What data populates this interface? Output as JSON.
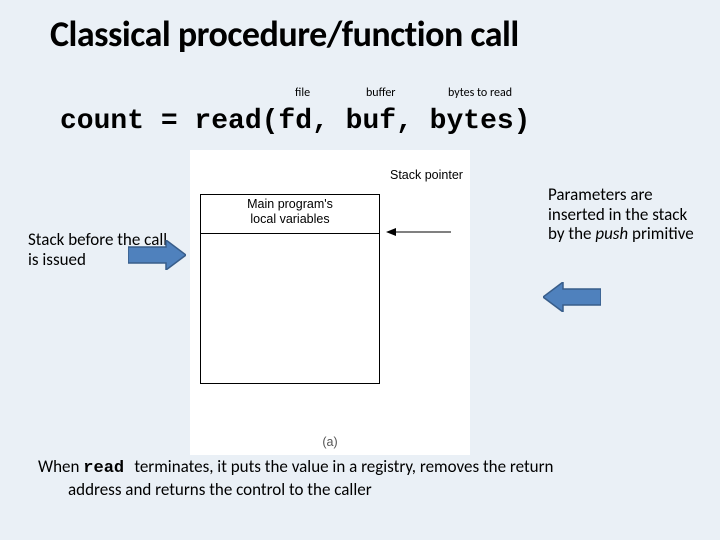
{
  "title": "Classical procedure/function call",
  "code": {
    "line": "count = read(fd, buf, bytes)",
    "annot_file": "file",
    "annot_buffer": "buffer",
    "annot_bytes": "bytes to read"
  },
  "left_caption": "Stack before the call is issued",
  "right_caption_pre": "Parameters are inserted in the stack by the ",
  "right_caption_italic": "push",
  "right_caption_post": " primitive",
  "figure": {
    "stack_text_l1": "Main program's",
    "stack_text_l2": "local variables",
    "sp_label": "Stack pointer",
    "sublabel": "(a)"
  },
  "footer": {
    "pre": "When ",
    "mono": "read ",
    "mid": " terminates, it puts the value in a registry, removes the return",
    "line2": "address and returns the control to the caller"
  }
}
